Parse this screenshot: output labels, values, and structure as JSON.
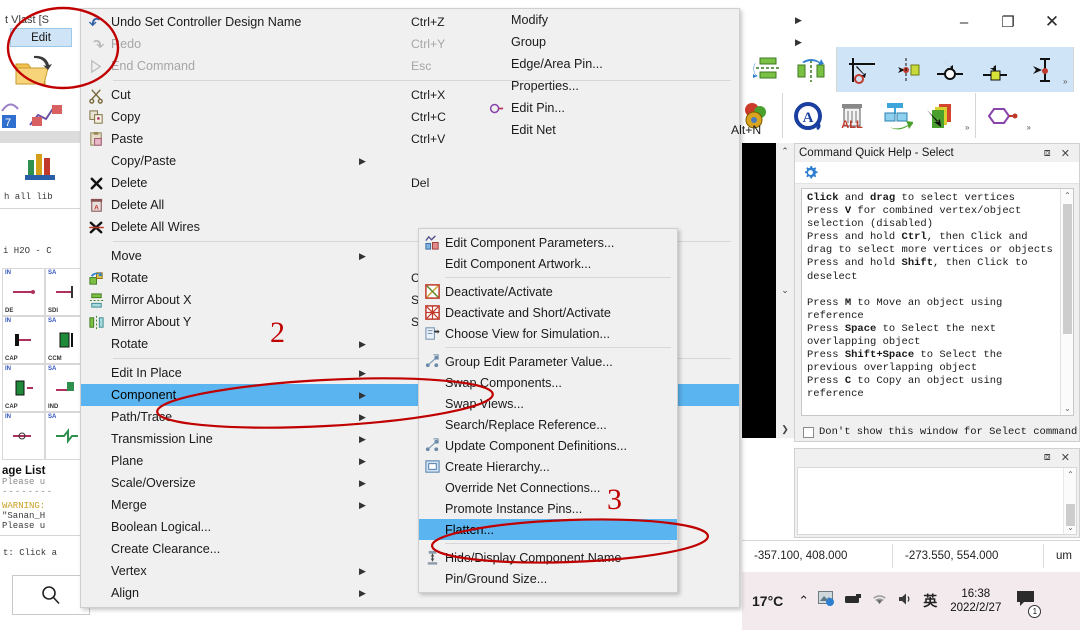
{
  "window": {
    "minimize": "–",
    "maximize": "❐",
    "close": "✕"
  },
  "left_panel": {
    "tab_label_partial": "t Vlast [S",
    "edit_tab": "Edit",
    "search_text_partial": "h all lib",
    "tree_text_partial": "i H2O - C",
    "message_list_title": "age List",
    "message_lines": [
      "Please u",
      "--------",
      "WARNING:",
      "\"Sanan_H",
      "Please u"
    ],
    "prompt_partial": "t: Click a",
    "search_icon": "search-icon",
    "library_cells": [
      {
        "tl": "IN",
        "bl": "DE"
      },
      {
        "tl": "SA",
        "bl": "SDI"
      },
      {
        "tl": "IN",
        "bl": "CAP"
      },
      {
        "tl": "SA",
        "bl": "CCM"
      },
      {
        "tl": "IN",
        "bl": "CAP"
      },
      {
        "tl": "SA",
        "bl": "IND"
      },
      {
        "tl": "IN",
        "bl": ""
      },
      {
        "tl": "SA",
        "bl": ""
      }
    ]
  },
  "toolbar": {
    "row1": [
      {
        "icon": "mirror-about-x-icon",
        "selected": false
      },
      {
        "icon": "mirror-about-y-icon",
        "selected": false
      },
      {
        "icon": "measure-distance-icon",
        "selected": true
      },
      {
        "icon": "snap-to-pin-icon",
        "selected": true
      },
      {
        "icon": "snap-to-vertex-icon",
        "selected": true
      },
      {
        "icon": "snap-to-object-icon",
        "selected": true
      },
      {
        "icon": "snap-to-edge-icon",
        "selected": true
      }
    ],
    "row1_overflow": "»",
    "row2": [
      {
        "icon": "palette-icon",
        "selected": false
      },
      {
        "icon": "annotate-icon",
        "selected": false
      },
      {
        "icon": "delete-all-icon",
        "selected": false
      },
      {
        "icon": "restore-view-icon",
        "selected": false
      },
      {
        "icon": "select-layer-icon",
        "selected": false
      }
    ],
    "row2_overflow": "»",
    "row3": [
      {
        "icon": "edit-pin-icon",
        "selected": false
      }
    ],
    "row3_overflow": "»"
  },
  "help_panel": {
    "title": "Command Quick Help - Select",
    "float_icon": "restore-pane-icon",
    "close_icon": "close-icon",
    "settings_icon": "gear-icon",
    "body_lines": [
      "<b>Click</b> and <b>drag</b> to select vertices",
      "Press <b>V</b> for combined vertex/object",
      "selection (disabled)",
      "Press and hold <b>Ctrl</b>, then Click and",
      "drag to select more vertices or objects",
      "Press and hold <b>Shift</b>, then Click to",
      "deselect",
      "",
      "Press <b>M</b> to Move an object using",
      "reference",
      "Press <b>Space</b> to Select the next",
      "overlapping object",
      "Press <b>Shift+Space</b> to Select the",
      "previous overlapping object",
      "Press <b>C</b> to Copy an object using",
      "reference"
    ],
    "dont_show_label": "Don't show this window for Select command",
    "scroll_up": "⌃",
    "scroll_down": "⌄"
  },
  "lower_panel": {
    "float_icon": "restore-pane-icon",
    "close_icon": "close-icon",
    "scroll_up": "⌃",
    "scroll_down": "⌄"
  },
  "statusbar": {
    "coord1": "-357.100, 408.000",
    "coord2": "-273.550, 554.000",
    "units": "um"
  },
  "tray": {
    "temperature": "17°C",
    "chevron": "⌃",
    "icons": [
      "photos-icon",
      "network-adapter-icon",
      "wifi-icon",
      "volume-icon"
    ],
    "ime": "英",
    "time": "16:38",
    "date": "2022/2/27",
    "notification_icon": "notifications-icon",
    "notification_count": "1"
  },
  "edit_menu": {
    "column1": [
      {
        "label": "Undo Set Controller Design Name",
        "accel": "Ctrl+Z",
        "icon": "undo-icon",
        "disabled": false,
        "arrow": false
      },
      {
        "label": "Redo",
        "accel": "Ctrl+Y",
        "icon": "redo-icon",
        "disabled": true,
        "arrow": false
      },
      {
        "label": "End Command",
        "accel": "Esc",
        "icon": "end-command-icon",
        "disabled": true,
        "arrow": false
      },
      {
        "separator": true
      },
      {
        "label": "Cut",
        "accel": "Ctrl+X",
        "icon": "cut-icon",
        "disabled": false,
        "arrow": false
      },
      {
        "label": "Copy",
        "accel": "Ctrl+C",
        "icon": "copy-icon",
        "disabled": false,
        "arrow": false
      },
      {
        "label": "Paste",
        "accel": "Ctrl+V",
        "icon": "paste-icon",
        "disabled": false,
        "arrow": false
      },
      {
        "label": "Copy/Paste",
        "accel": "",
        "icon": "",
        "disabled": false,
        "arrow": true
      },
      {
        "label": "Delete",
        "accel": "Del",
        "icon": "delete-icon",
        "disabled": false,
        "arrow": false
      },
      {
        "label": "Delete All",
        "accel": "",
        "icon": "delete-all-icon",
        "disabled": false,
        "arrow": false
      },
      {
        "label": "Delete All Wires",
        "accel": "",
        "icon": "delete-all-wires-icon",
        "disabled": false,
        "arrow": false
      },
      {
        "separator": true
      },
      {
        "label": "Move",
        "accel": "",
        "icon": "",
        "disabled": false,
        "arrow": true
      },
      {
        "label": "Rotate",
        "accel": "Ctrl+R",
        "icon": "rotate-icon",
        "disabled": false,
        "arrow": false
      },
      {
        "label": "Mirror About X",
        "accel": "Shift+X",
        "icon": "mirror-x-icon",
        "disabled": false,
        "arrow": false
      },
      {
        "label": "Mirror About Y",
        "accel": "Shift+Y",
        "icon": "mirror-y-icon",
        "disabled": false,
        "arrow": false
      },
      {
        "label": "Rotate",
        "accel": "",
        "icon": "",
        "disabled": false,
        "arrow": true
      },
      {
        "separator": true
      },
      {
        "label": "Edit In Place",
        "accel": "",
        "icon": "",
        "disabled": false,
        "arrow": true
      },
      {
        "label": "Component",
        "accel": "",
        "icon": "",
        "disabled": false,
        "arrow": true,
        "highlighted": true
      },
      {
        "label": "Path/Trace",
        "accel": "",
        "icon": "",
        "disabled": false,
        "arrow": true
      },
      {
        "label": "Transmission Line",
        "accel": "",
        "icon": "",
        "disabled": false,
        "arrow": true
      },
      {
        "label": "Plane",
        "accel": "",
        "icon": "",
        "disabled": false,
        "arrow": true
      },
      {
        "label": "Scale/Oversize",
        "accel": "",
        "icon": "",
        "disabled": false,
        "arrow": true
      },
      {
        "label": "Merge",
        "accel": "",
        "icon": "",
        "disabled": false,
        "arrow": true
      },
      {
        "label": "Boolean Logical...",
        "accel": "",
        "icon": "",
        "disabled": false,
        "arrow": false
      },
      {
        "label": "Create Clearance...",
        "accel": "",
        "icon": "",
        "disabled": false,
        "arrow": false
      },
      {
        "label": "Vertex",
        "accel": "",
        "icon": "",
        "disabled": false,
        "arrow": true
      },
      {
        "label": "Align",
        "accel": "",
        "icon": "",
        "disabled": false,
        "arrow": true
      }
    ],
    "column2": [
      {
        "label": "Modify",
        "accel": "",
        "icon": "",
        "disabled": false,
        "arrow": true
      },
      {
        "label": "Group",
        "accel": "",
        "icon": "",
        "disabled": false,
        "arrow": true
      },
      {
        "label": "Edge/Area Pin...",
        "accel": "",
        "icon": "",
        "disabled": false,
        "arrow": false
      },
      {
        "label": "Properties...",
        "accel": "",
        "icon": "",
        "disabled": false,
        "arrow": false
      },
      {
        "label": "Edit Pin...",
        "accel": "",
        "icon": "edit-pin-icon",
        "disabled": false,
        "arrow": false
      },
      {
        "label": "Edit Net",
        "accel": "Alt+N",
        "icon": "",
        "disabled": false,
        "arrow": false
      }
    ]
  },
  "component_submenu": [
    {
      "label": "Edit Component Parameters...",
      "icon": "edit-component-parameters-icon"
    },
    {
      "label": "Edit Component Artwork...",
      "icon": ""
    },
    {
      "separator": true
    },
    {
      "label": "Deactivate/Activate",
      "icon": "deactivate-activate-icon"
    },
    {
      "label": "Deactivate and Short/Activate",
      "icon": "deactivate-short-icon"
    },
    {
      "label": "Choose View for Simulation...",
      "icon": "choose-view-icon"
    },
    {
      "separator": true
    },
    {
      "label": "Group Edit Parameter Value...",
      "icon": "group-edit-icon"
    },
    {
      "label": "Swap Components...",
      "icon": ""
    },
    {
      "label": "Swap Views...",
      "icon": ""
    },
    {
      "label": "Search/Replace Reference...",
      "icon": ""
    },
    {
      "label": "Update Component Definitions...",
      "icon": "update-definitions-icon"
    },
    {
      "label": "Create Hierarchy...",
      "icon": "create-hierarchy-icon"
    },
    {
      "label": "Override Net Connections...",
      "icon": ""
    },
    {
      "label": "Promote Instance Pins...",
      "icon": ""
    },
    {
      "label": "Flatten...",
      "icon": "",
      "highlighted": true
    },
    {
      "separator": true
    },
    {
      "label": "Hide/Display Component Name",
      "icon": "hide-display-name-icon"
    },
    {
      "label": "Pin/Ground Size...",
      "icon": ""
    }
  ],
  "annotations": {
    "marker_2": "2",
    "marker_3": "3",
    "accent_color": "#c00000",
    "highlight_color": "#5ab4ef"
  }
}
